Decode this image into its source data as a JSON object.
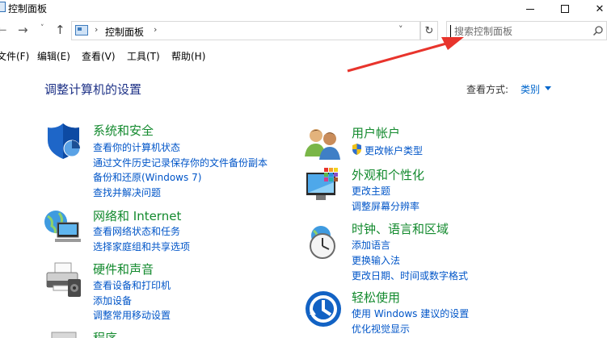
{
  "window": {
    "title": "控制面板"
  },
  "address": {
    "crumb": "控制面板",
    "search_placeholder": "搜索控制面板"
  },
  "menu": [
    "文件(F)",
    "编辑(E)",
    "查看(V)",
    "工具(T)",
    "帮助(H)"
  ],
  "content": {
    "heading": "调整计算机的设置",
    "view_label": "查看方式:",
    "view_value": "类别"
  },
  "categories": {
    "system": {
      "title": "系统和安全",
      "links": [
        "查看你的计算机状态",
        "通过文件历史记录保存你的文件备份副本",
        "备份和还原(Windows 7)",
        "查找并解决问题"
      ]
    },
    "network": {
      "title": "网络和 Internet",
      "links": [
        "查看网络状态和任务",
        "选择家庭组和共享选项"
      ]
    },
    "hardware": {
      "title": "硬件和声音",
      "links": [
        "查看设备和打印机",
        "添加设备",
        "调整常用移动设置"
      ]
    },
    "programs": {
      "title": "程序"
    },
    "accounts": {
      "title": "用户帐户",
      "links": [
        "更改帐户类型"
      ]
    },
    "appearance": {
      "title": "外观和个性化",
      "links": [
        "更改主题",
        "调整屏幕分辨率"
      ]
    },
    "clock": {
      "title": "时钟、语言和区域",
      "links": [
        "添加语言",
        "更换输入法",
        "更改日期、时间或数字格式"
      ]
    },
    "ease": {
      "title": "轻松使用",
      "links": [
        "使用 Windows 建议的设置",
        "优化视觉显示"
      ]
    }
  },
  "colors": {
    "category_title": "#138a2e",
    "link": "#0055c8",
    "heading": "#1e3287",
    "annotation_arrow": "#e8342c"
  },
  "icons": {
    "title": "control-panel-icon",
    "search": "search-icon",
    "refresh": "refresh-icon",
    "system": "shield-icon",
    "network": "globe-network-icon",
    "hardware": "printer-icon",
    "accounts": "users-icon",
    "appearance": "monitor-palette-icon",
    "clock": "clock-globe-icon",
    "ease": "ease-of-access-icon"
  }
}
